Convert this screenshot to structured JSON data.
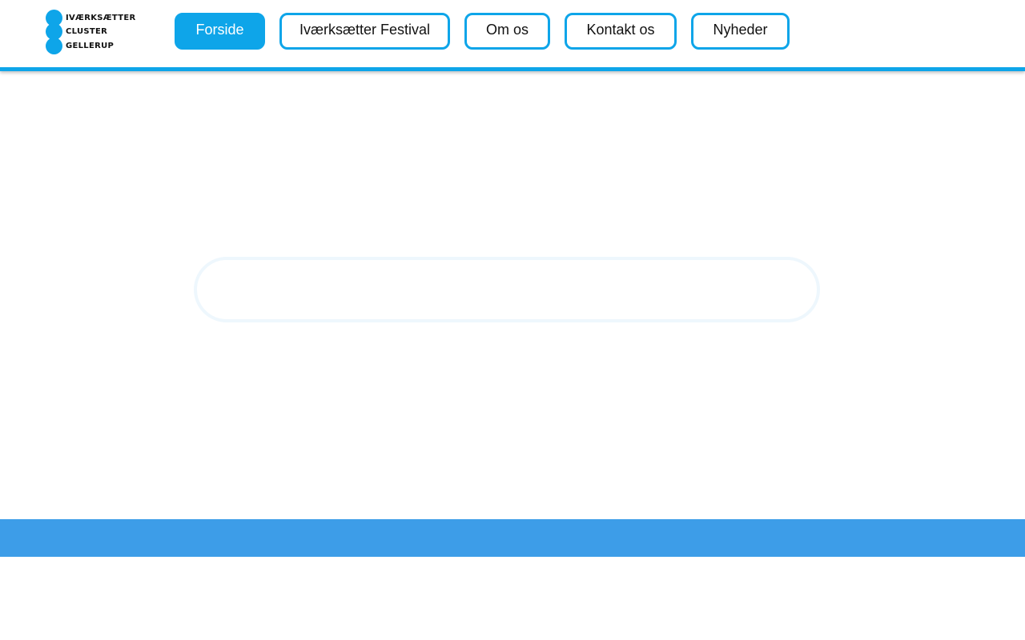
{
  "logo": {
    "line1": "IVÆRKSÆTTER",
    "line2": "CLUSTER",
    "line3": "GELLERUP"
  },
  "nav": {
    "items": [
      {
        "label": "Forside",
        "active": true
      },
      {
        "label": "Iværksætter Festival",
        "active": false
      },
      {
        "label": "Om os",
        "active": false
      },
      {
        "label": "Kontakt os",
        "active": false
      },
      {
        "label": "Nyheder",
        "active": false
      }
    ]
  },
  "colors": {
    "accent": "#0ea5e9",
    "footer": "#3d9de8",
    "background": "#ffffff"
  }
}
